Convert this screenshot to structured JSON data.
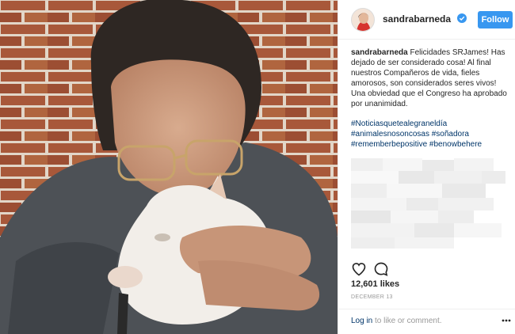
{
  "header": {
    "username": "sandrabarneda",
    "follow_label": "Follow"
  },
  "caption": {
    "username": "sandrabarneda",
    "text": "Felicidades SRJames! Has dejado de ser considerado cosa! Al final nuestros Compañeros de vida, fieles amorosos, son considerados seres vivos! Una obviedad que el Congreso ha aprobado por unanimidad."
  },
  "hashtags": [
    "#Noticiasquetealegraneldía",
    "#animalesnosoncosas #soñadora",
    "#rememberbepositive #benowbehere"
  ],
  "stats": {
    "likes": "12,601 likes",
    "date": "December 13"
  },
  "footer": {
    "login_link": "Log in",
    "login_rest": " to like or comment."
  },
  "icons": {
    "like": "heart-icon",
    "comment": "comment-icon",
    "more": "more-options-icon",
    "verified": "verified-badge-icon"
  },
  "colors": {
    "follow_button": "#3897f0",
    "link": "#003569",
    "verified": "#3897f0"
  }
}
